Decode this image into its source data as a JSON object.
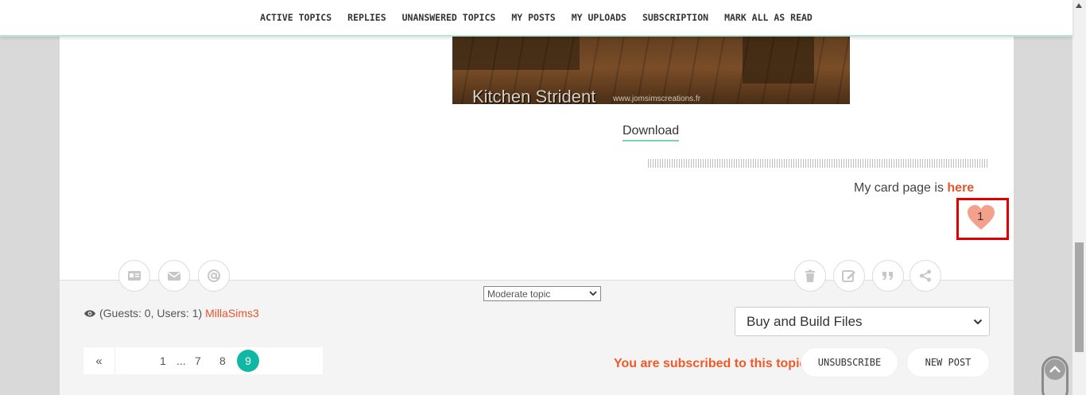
{
  "nav": {
    "items": [
      "ACTIVE TOPICS",
      "REPLIES",
      "UNANSWERED TOPICS",
      "MY POSTS",
      "MY UPLOADS",
      "SUBSCRIPTION",
      "MARK ALL AS READ"
    ]
  },
  "post": {
    "image_caption": "Kitchen Strident",
    "image_url_text": "www.jomsimscreations.fr",
    "download_label": "Download",
    "card_text": "My card page is ",
    "card_link": "here",
    "like_count": "1"
  },
  "icons": {
    "left": [
      "profile-card-icon",
      "envelope-icon",
      "at-sign-icon"
    ],
    "right": [
      "trash-icon",
      "edit-icon",
      "quote-icon",
      "share-icon"
    ]
  },
  "footer": {
    "moderate_label": "Moderate topic",
    "viewers_text": "(Guests: 0, Users: 1)",
    "viewer_user": "MillaSims3",
    "forum_select": "Buy and Build Files",
    "pagination": {
      "prev": "«",
      "pages": [
        "1",
        "...",
        "7",
        "8"
      ],
      "current": "9"
    },
    "subscribed_text": "You are subscribed to this topic:",
    "unsubscribe_label": "UNSUBSCRIBE",
    "new_post_label": "NEW POST"
  },
  "colors": {
    "accent_orange": "#e8542a",
    "accent_teal": "#10b7a3",
    "highlight_red": "#e00000",
    "heart": "#f4a08a"
  }
}
